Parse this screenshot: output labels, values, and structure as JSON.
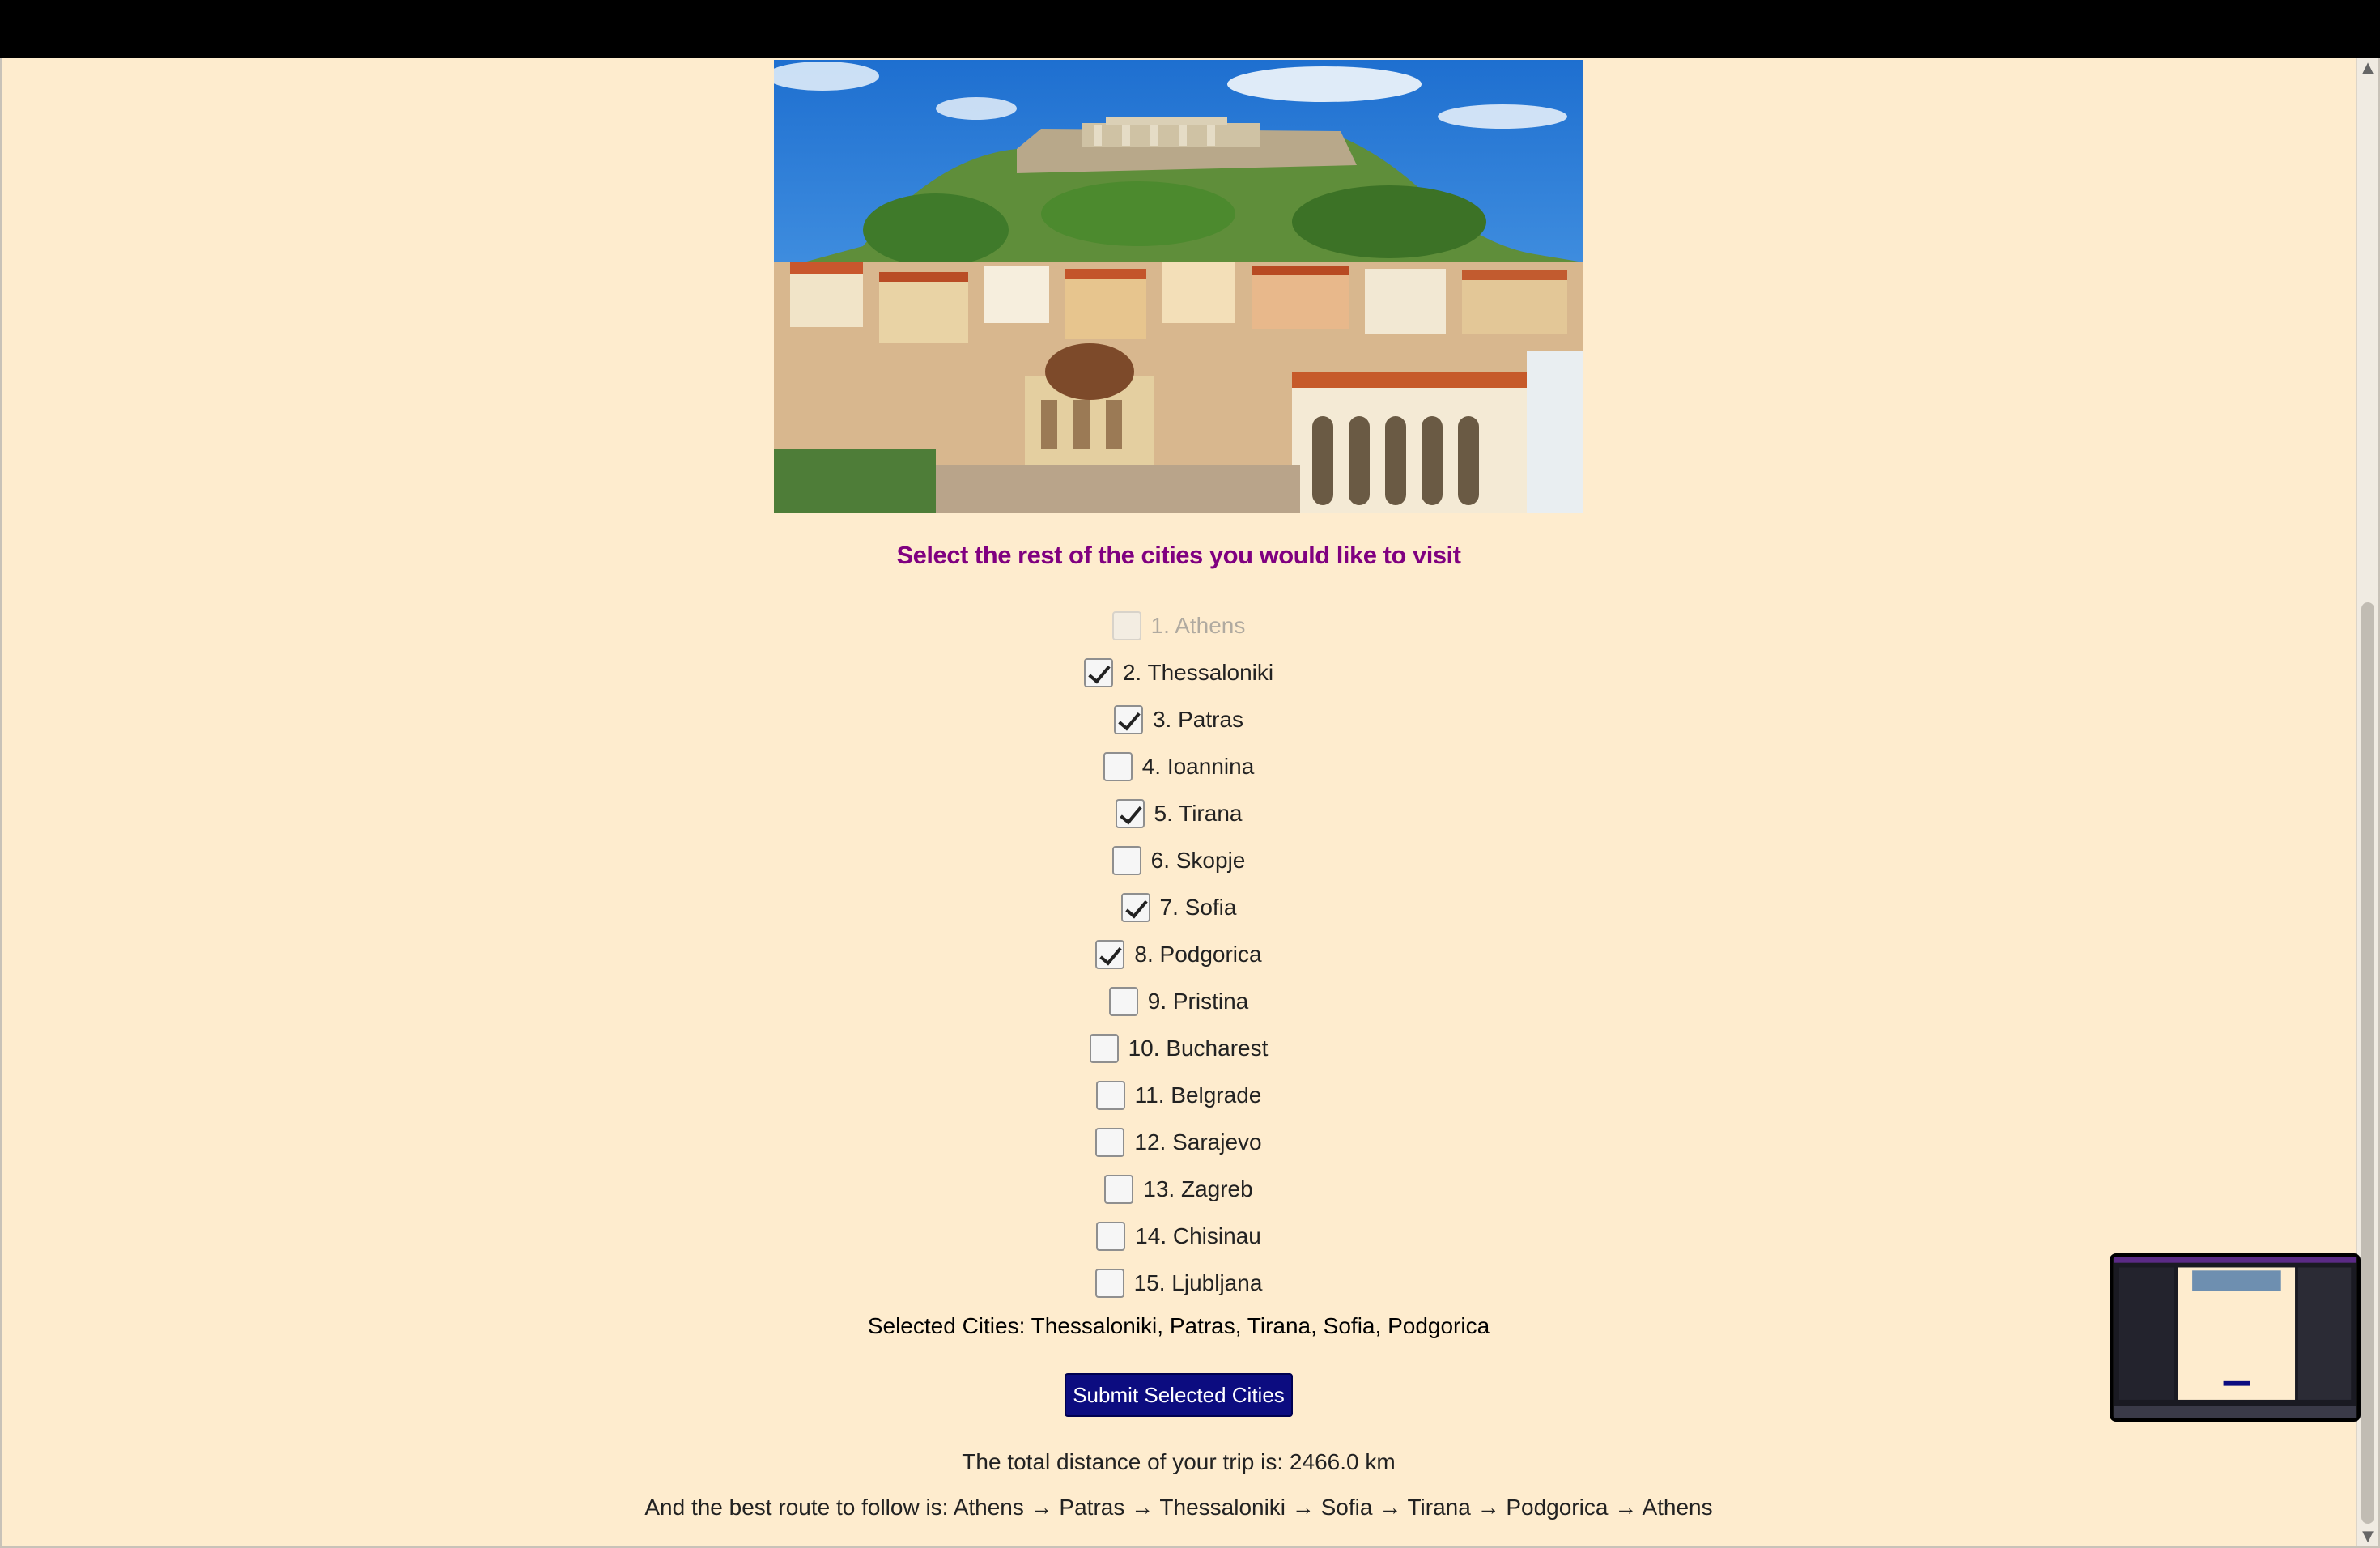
{
  "heading": "Select the rest of the cities you would like to visit",
  "cities": [
    {
      "label": "1. Athens",
      "checked": false,
      "disabled": true
    },
    {
      "label": "2. Thessaloniki",
      "checked": true,
      "disabled": false
    },
    {
      "label": "3. Patras",
      "checked": true,
      "disabled": false
    },
    {
      "label": "4. Ioannina",
      "checked": false,
      "disabled": false
    },
    {
      "label": "5. Tirana",
      "checked": true,
      "disabled": false
    },
    {
      "label": "6. Skopje",
      "checked": false,
      "disabled": false
    },
    {
      "label": "7. Sofia",
      "checked": true,
      "disabled": false
    },
    {
      "label": "8. Podgorica",
      "checked": true,
      "disabled": false
    },
    {
      "label": "9. Pristina",
      "checked": false,
      "disabled": false
    },
    {
      "label": "10. Bucharest",
      "checked": false,
      "disabled": false
    },
    {
      "label": "11. Belgrade",
      "checked": false,
      "disabled": false
    },
    {
      "label": "12. Sarajevo",
      "checked": false,
      "disabled": false
    },
    {
      "label": "13. Zagreb",
      "checked": false,
      "disabled": false
    },
    {
      "label": "14. Chisinau",
      "checked": false,
      "disabled": false
    },
    {
      "label": "15. Ljubljana",
      "checked": false,
      "disabled": false
    }
  ],
  "selected_text": "Selected Cities: Thessaloniki, Patras, Tirana, Sofia, Podgorica",
  "submit_label": "Submit Selected Cities",
  "distance_text": "The total distance of your trip is: 2466.0 km",
  "route_text": "And the best route to follow is: Athens → Patras → Thessaloniki → Sofia → Tirana → Podgorica → Athens",
  "colors": {
    "page_background": "#feecce",
    "heading": "#800080",
    "button_background": "#0c0c80",
    "button_text": "#ffffff"
  },
  "icons": {
    "scroll_up": "chevron-up-icon",
    "scroll_down": "chevron-down-icon"
  }
}
